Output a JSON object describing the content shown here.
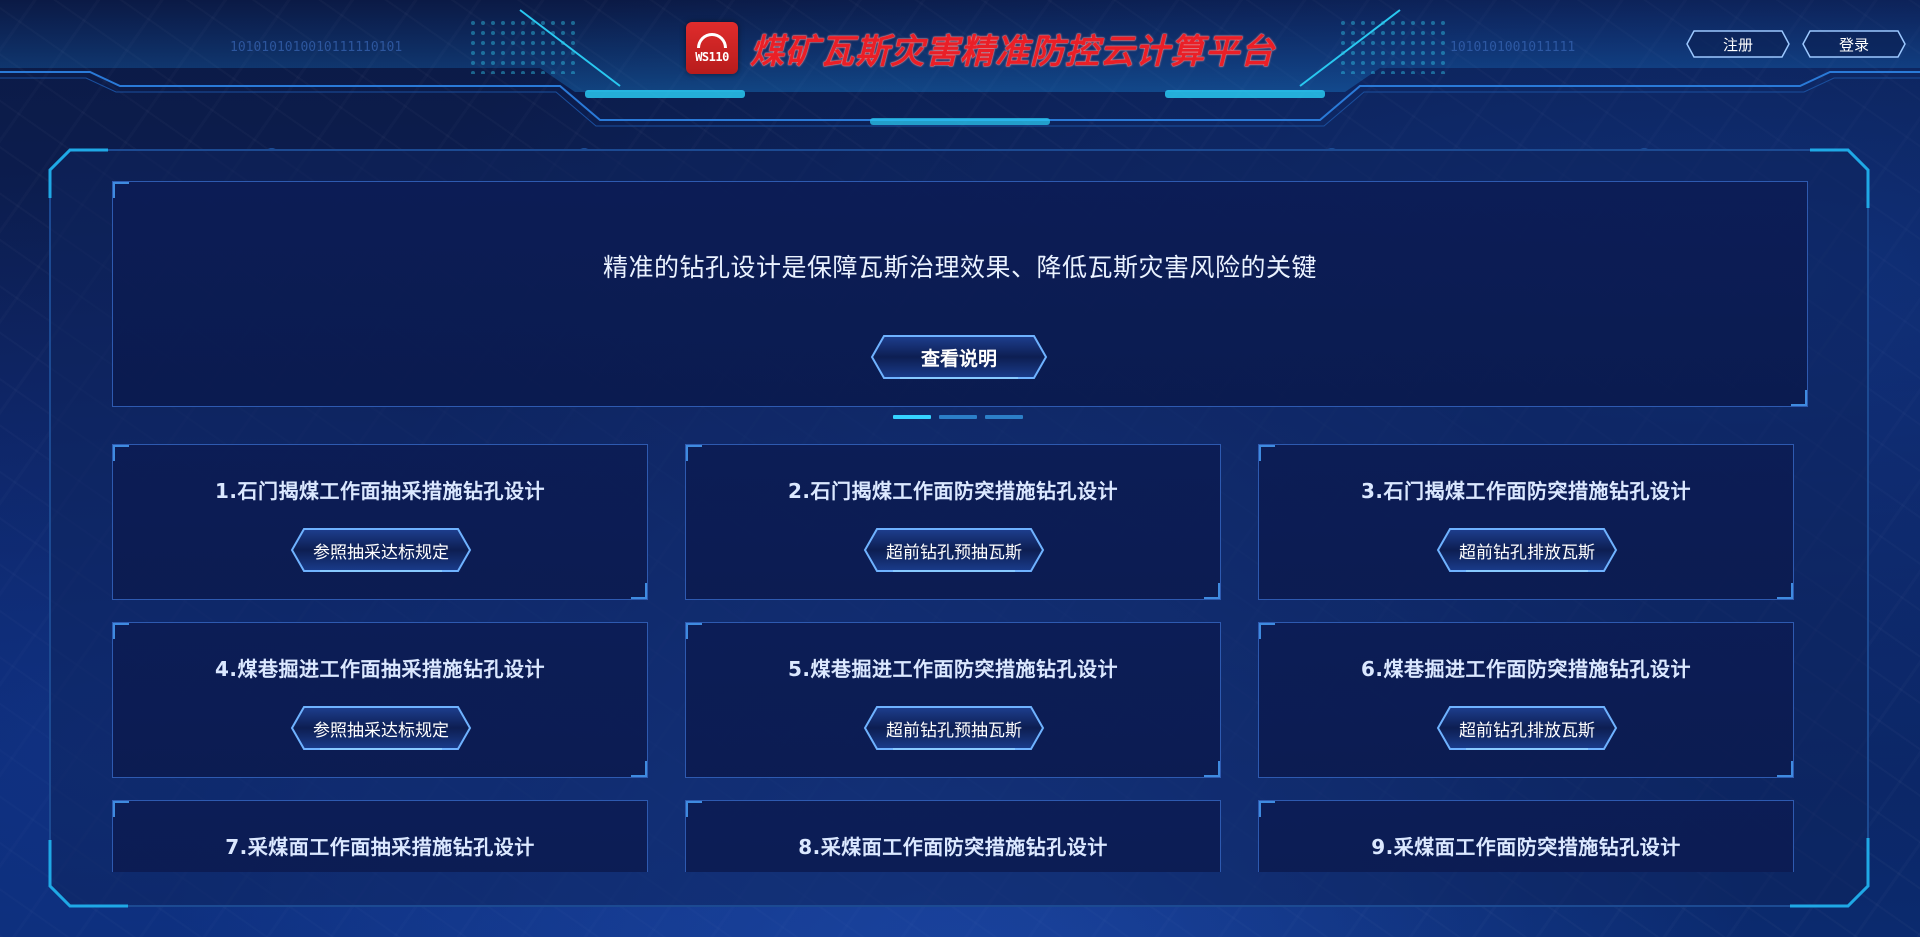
{
  "header": {
    "title": "煤矿瓦斯灾害精准防控云计算平台",
    "logo_text": "WS110",
    "register_label": "注册",
    "login_label": "登录",
    "binary_left": "1010101010010111110101",
    "binary_right": "1010101001011111"
  },
  "banner": {
    "text": "精准的钻孔设计是保障瓦斯治理效果、降低瓦斯灾害风险的关键",
    "button_label": "查看说明",
    "pager_count": 3,
    "pager_active": 0
  },
  "cards": [
    {
      "title": "1.石门揭煤工作面抽采措施钻孔设计",
      "button": "参照抽采达标规定"
    },
    {
      "title": "2.石门揭煤工作面防突措施钻孔设计",
      "button": "超前钻孔预抽瓦斯"
    },
    {
      "title": "3.石门揭煤工作面防突措施钻孔设计",
      "button": "超前钻孔排放瓦斯"
    },
    {
      "title": "4.煤巷掘进工作面抽采措施钻孔设计",
      "button": "参照抽采达标规定"
    },
    {
      "title": "5.煤巷掘进工作面防突措施钻孔设计",
      "button": "超前钻孔预抽瓦斯"
    },
    {
      "title": "6.煤巷掘进工作面防突措施钻孔设计",
      "button": "超前钻孔排放瓦斯"
    },
    {
      "title": "7.采煤面工作面抽采措施钻孔设计",
      "button": ""
    },
    {
      "title": "8.采煤面工作面防突措施钻孔设计",
      "button": ""
    },
    {
      "title": "9.采煤面工作面防突措施钻孔设计",
      "button": ""
    }
  ],
  "colors": {
    "accent": "#35d3ff",
    "brand_red": "#ea1f27",
    "panel_border": "#2e5ab0",
    "frame_cyan": "#1fa9e6"
  }
}
